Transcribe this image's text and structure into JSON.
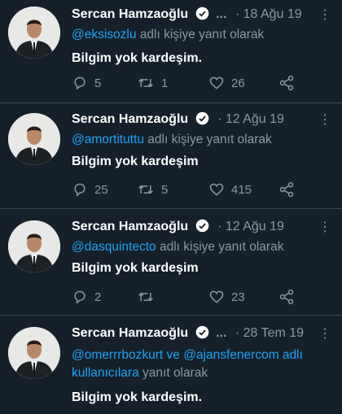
{
  "tweets": [
    {
      "name": "Sercan Hamzaoğlu",
      "ellipsis": "...",
      "date": "· 18 Ağu 19",
      "more": "⋮",
      "mentions": [
        "@eksisozlu"
      ],
      "reply_suffix": "adlı kişiye yanıt olarak",
      "text": "Bilgim yok kardeşim.",
      "replies": "5",
      "retweets": "1",
      "likes": "26"
    },
    {
      "name": "Sercan Hamzaoğlu",
      "ellipsis": "",
      "date": "· 12 Ağu 19",
      "more": "⋮",
      "mentions": [
        "@amortituttu"
      ],
      "reply_suffix": "adlı kişiye yanıt olarak",
      "text": "Bilgim yok kardeşim",
      "replies": "25",
      "retweets": "5",
      "likes": "415"
    },
    {
      "name": "Sercan Hamzaoğlu",
      "ellipsis": "",
      "date": "· 12 Ağu 19",
      "more": "⋮",
      "mentions": [
        "@dasquintecto"
      ],
      "reply_suffix": "adlı kişiye yanıt olarak",
      "text": "Bilgim yok kardeşim",
      "replies": "2",
      "retweets": "",
      "likes": "23"
    },
    {
      "name": "Sercan Hamzaoğlu",
      "ellipsis": "...",
      "date": "· 28 Tem 19",
      "more": "⋮",
      "mentions": [
        "@omerrrbozkurt",
        "@ajansfenercom"
      ],
      "mention_joiner": "ve",
      "mention_tail": "adlı",
      "mention_line2": "kullanıcılara",
      "reply_suffix": "yanıt olarak",
      "text": "Bilgim yok kardeşim.",
      "replies": "",
      "retweets": "",
      "likes": ""
    }
  ],
  "colors": {
    "background": "#15202b",
    "muted": "#8899a6",
    "accent": "#1da1f2",
    "divider": "#38444d"
  },
  "icons": {
    "reply": "reply-icon",
    "retweet": "retweet-icon",
    "like": "heart-icon",
    "share": "share-icon",
    "verified": "verified-badge-icon",
    "more": "more-vertical-icon"
  }
}
